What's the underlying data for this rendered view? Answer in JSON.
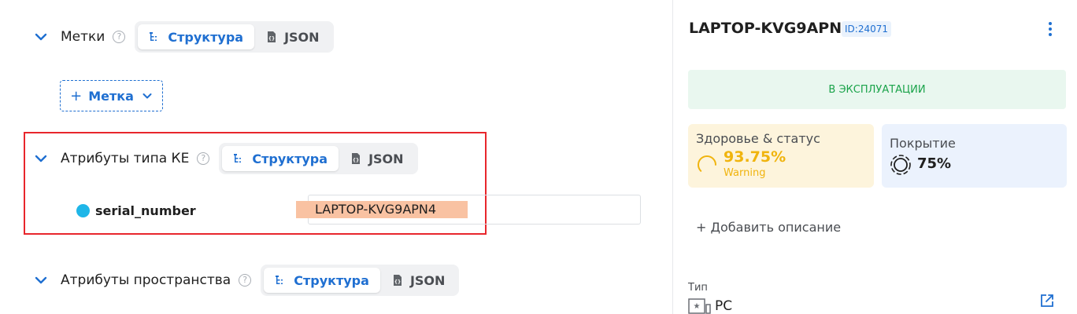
{
  "sections": {
    "tags": {
      "label": "Метки",
      "help": "?",
      "tab_structure": "Структура",
      "tab_json": "JSON"
    },
    "add_tag": {
      "plus": "+",
      "label": "Метка"
    },
    "ke_attrs": {
      "label": "Атрибуты типа КЕ",
      "help": "?",
      "tab_structure": "Структура",
      "tab_json": "JSON"
    },
    "attribute": {
      "name": "serial_number",
      "value": "LAPTOP-KVG9APN4"
    },
    "space_attrs": {
      "label": "Атрибуты пространства",
      "help": "?",
      "tab_structure": "Структура",
      "tab_json": "JSON"
    }
  },
  "panel": {
    "title": "LAPTOP-KVG9APN4",
    "id_badge": "ID:24071",
    "status": "В ЭКСПЛУАТАЦИИ",
    "health": {
      "title": "Здоровье & статус",
      "value": "93.75%",
      "sub": "Warning",
      "fraction": 0.9375
    },
    "coverage": {
      "title": "Покрытие",
      "value": "75%",
      "fraction": 0.75
    },
    "add_description": "+ Добавить описание",
    "type_label": "Тип",
    "type_value": "PC"
  },
  "colors": {
    "accent": "#1f6fd1",
    "status_green": "#1aa34a",
    "warning": "#f0b40e",
    "highlight_border": "#e8262c",
    "value_highlight": "#f9c2a2"
  },
  "icons": [
    "chevron-down-icon",
    "help-icon",
    "structure-icon",
    "json-file-icon",
    "kebab-menu-icon",
    "health-ring-icon",
    "coverage-ring-icon",
    "pc-type-icon",
    "external-link-icon"
  ]
}
